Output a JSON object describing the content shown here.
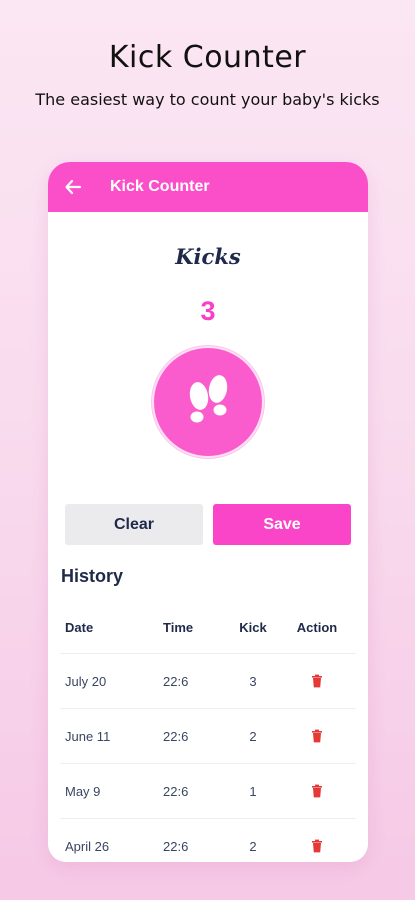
{
  "promo": {
    "title": "Kick Counter",
    "subtitle": "The easiest way to count your baby's kicks"
  },
  "app_bar": {
    "back_icon": "arrow-left-icon",
    "title": "Kick Counter"
  },
  "counter": {
    "label": "Kicks",
    "count": "3",
    "button_icon": "footprints-icon"
  },
  "actions": {
    "clear_label": "Clear",
    "save_label": "Save"
  },
  "history": {
    "title": "History",
    "columns": {
      "date": "Date",
      "time": "Time",
      "kick": "Kick",
      "action": "Action"
    },
    "rows": [
      {
        "date": "July 20",
        "time": "22:6",
        "kick": "3"
      },
      {
        "date": "June 11",
        "time": "22:6",
        "kick": "2"
      },
      {
        "date": "May 9",
        "time": "22:6",
        "kick": "1"
      },
      {
        "date": "April 26",
        "time": "22:6",
        "kick": "2"
      }
    ]
  },
  "colors": {
    "accent": "#fb4fc9",
    "delete": "#e53935",
    "text_dark": "#1f2a4a"
  }
}
